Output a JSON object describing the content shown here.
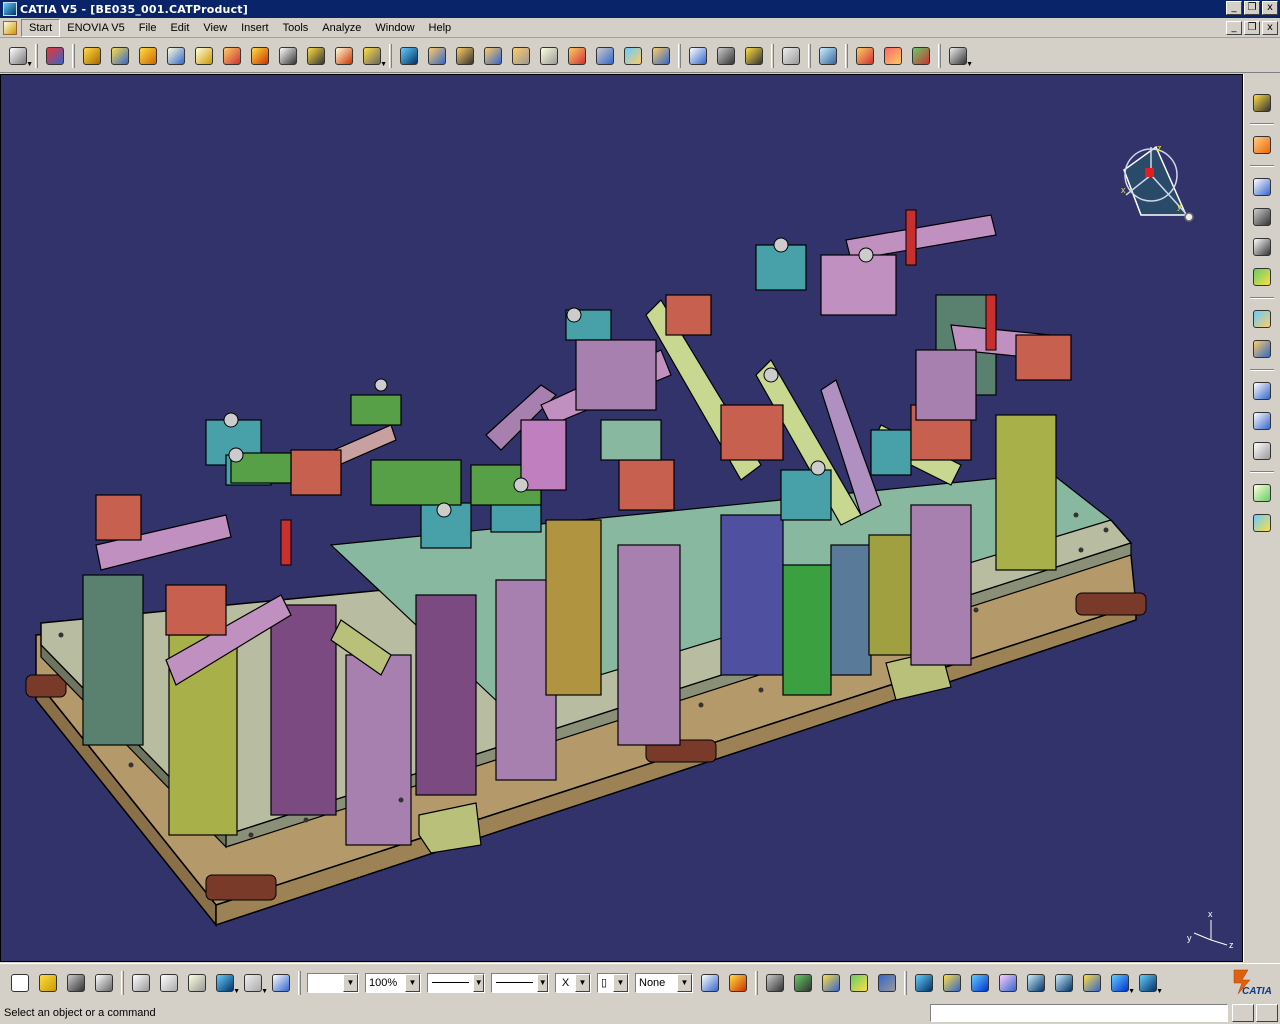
{
  "window": {
    "title": "CATIA V5 - [BE035_001.CATProduct]",
    "minimize": "_",
    "restore": "❐",
    "close": "x"
  },
  "menu": [
    {
      "label": "Start",
      "active": true
    },
    {
      "label": "ENOVIA V5"
    },
    {
      "label": "File"
    },
    {
      "label": "Edit"
    },
    {
      "label": "View"
    },
    {
      "label": "Insert"
    },
    {
      "label": "Tools"
    },
    {
      "label": "Analyze"
    },
    {
      "label": "Window"
    },
    {
      "label": "Help"
    }
  ],
  "bottom_toolbar": {
    "color_value": "",
    "transparency_value": "100%",
    "linetype_value": "",
    "thickness_value": "",
    "point_symbol_value": "X",
    "layer_value": "None"
  },
  "status": {
    "prompt": "Select an object or a command",
    "command_value": ""
  },
  "compass": {
    "axis_x": "x",
    "axis_y": "y",
    "axis_z": "z"
  },
  "axis_triad": {
    "x": "x",
    "y": "y",
    "z": "z"
  },
  "brand": {
    "logo_text": "CATIA"
  },
  "colors": {
    "viewport_bg": "#33336b",
    "titlebar": "#0a246a",
    "chrome": "#d4d0c8"
  },
  "icons": {
    "top_toolbar": [
      "select-arrow-icon",
      "catalog-browser-icon",
      "new-component-icon",
      "new-product-icon",
      "new-part-icon",
      "existing-component-icon",
      "replace-component-icon",
      "graph-tree-reorder-icon",
      "generate-numbering-icon",
      "selective-load-icon",
      "manage-representations-icon",
      "multi-instantiation-icon",
      "manipulation-icon",
      "snap-icon",
      "explode-icon",
      "stop-manipulate-icon",
      "coincidence-constraint-icon",
      "contact-constraint-icon",
      "offset-constraint-icon",
      "angle-constraint-icon",
      "fix-component-icon",
      "fix-together-icon",
      "quick-constraint-icon",
      "measure-between-icon",
      "measure-item-icon",
      "measure-inertia-icon",
      "update-icon",
      "scene-icon",
      "sectioning-icon",
      "clash-icon",
      "distance-band-icon",
      "bom-icon"
    ],
    "right_toolbar": [
      "sketcher-icon",
      "select-icon",
      "space-analysis-icon",
      "product-structure-icon",
      "constraints-icon",
      "move-icon",
      "annotation-icon",
      "text-icon",
      "flag-note-icon",
      "catalog-icon",
      "generative-view-icon"
    ],
    "bottom_toolbar": [
      "new-icon",
      "open-icon",
      "save-icon",
      "print-icon",
      "cut-icon",
      "copy-icon",
      "paste-icon",
      "undo-icon",
      "redo-icon",
      "whats-this-icon",
      "format-painter-icon",
      "graphic-properties-icon",
      "knowledge-formula-icon",
      "parameters-icon",
      "design-table-icon",
      "law-icon",
      "fly-mode-icon",
      "fit-all-icon",
      "pan-icon",
      "rotate-icon",
      "zoom-in-icon",
      "zoom-out-icon",
      "normal-view-icon",
      "isometric-view-icon",
      "render-style-icon"
    ]
  }
}
